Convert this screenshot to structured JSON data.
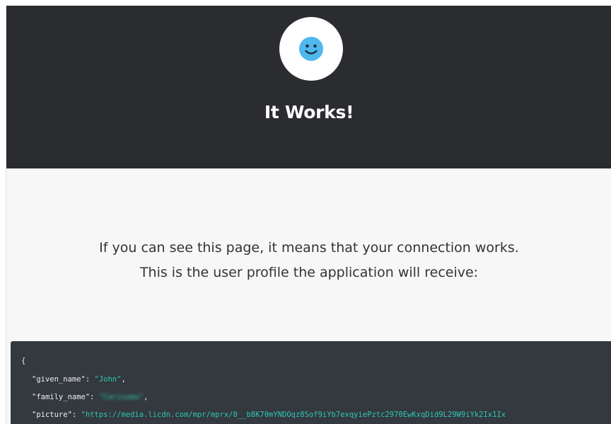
{
  "header": {
    "title": "It Works!",
    "avatar_icon": "smiley-face-icon",
    "background_color": "#2b2c2f"
  },
  "main": {
    "message_line1": "If you can see this page, it means that your connection works.",
    "message_line2": "This is the user profile the application will receive:"
  },
  "profile_json": {
    "open_brace": "{",
    "given_name_key": "\"given_name\":",
    "given_name_value": "\"John\"",
    "family_name_key": "\"family_name\":",
    "family_name_value": "\"Carisumo\"",
    "picture_key": "\"picture\":",
    "picture_value": "\"https://media.licdn.com/mpr/mprx/0__b8K70mYNDOqz8Sof9iYb7exqyiePztc2970EwKxqDid9L29W9iYk2Ix1Ix"
  },
  "colors": {
    "json_string": "#2fc5b5",
    "code_background": "#33393e"
  }
}
